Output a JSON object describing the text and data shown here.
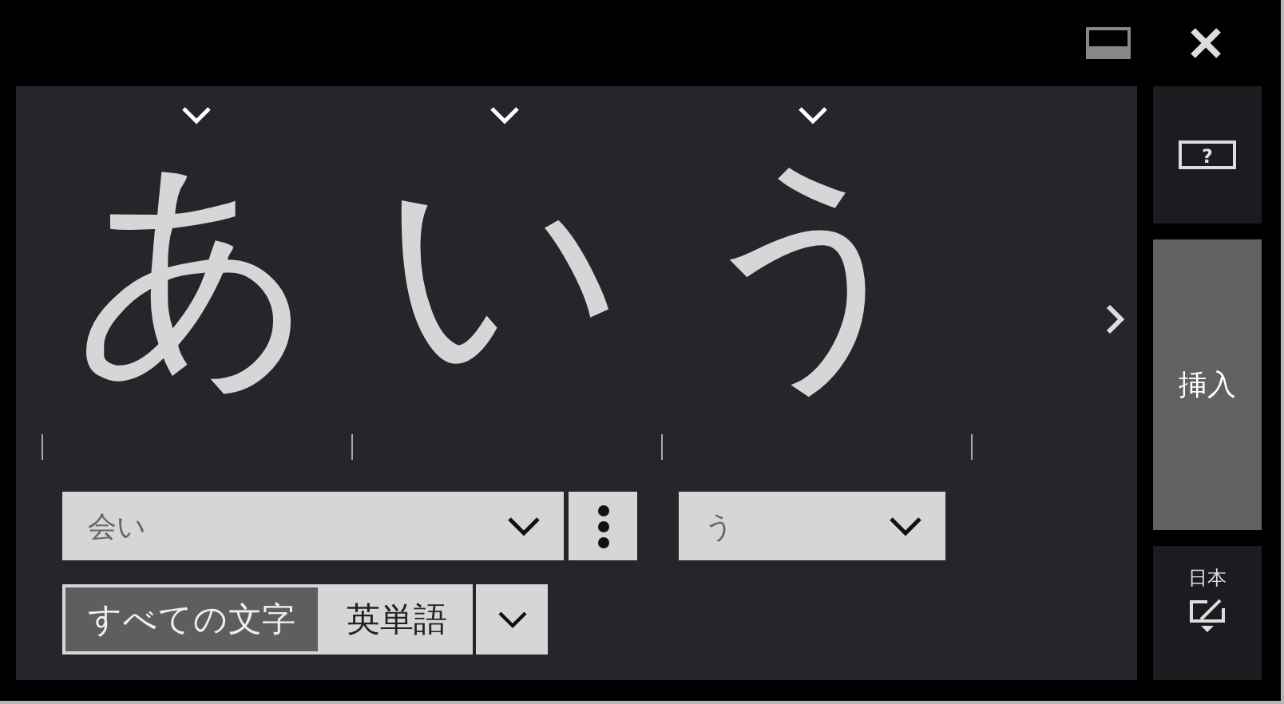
{
  "characters": [
    {
      "char": "あ"
    },
    {
      "char": "い"
    },
    {
      "char": "う"
    }
  ],
  "candidates": [
    {
      "value": "会い",
      "has_more": true
    },
    {
      "value": "う",
      "has_more": false
    }
  ],
  "filters": [
    {
      "label": "すべての文字",
      "selected": true
    },
    {
      "label": "英単語",
      "selected": false
    }
  ],
  "help_button": "?",
  "insert_button": "挿入",
  "language": "日本"
}
